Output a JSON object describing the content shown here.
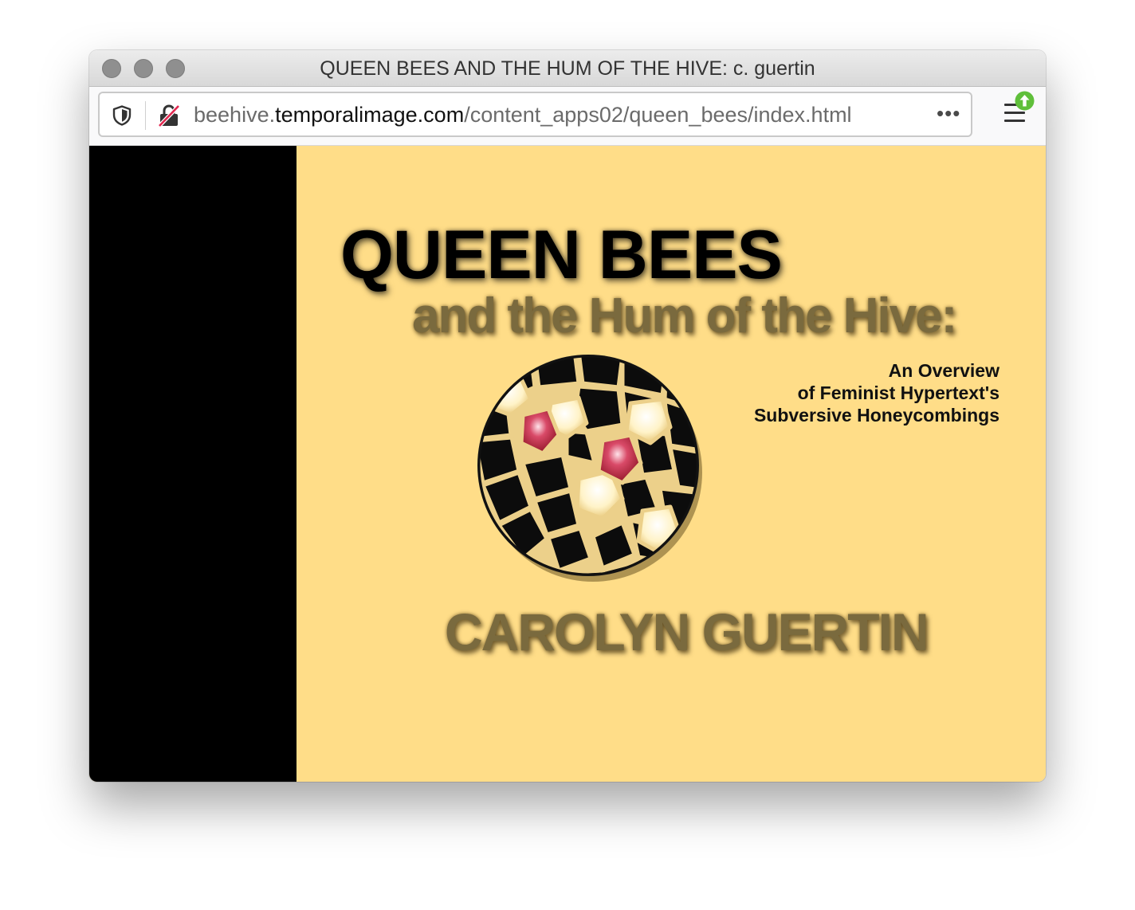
{
  "window": {
    "title": "QUEEN BEES AND THE HUM OF THE HIVE: c. guertin"
  },
  "urlbar": {
    "url_prefix": "beehive.",
    "url_host": "temporalimage.com",
    "url_path": "/content_apps02/queen_bees/index.html",
    "more_label": "•••"
  },
  "icons": {
    "tracking": "shield-icon",
    "security": "insecure-lock-icon",
    "menu": "hamburger-menu-icon",
    "update": "update-arrow-icon"
  },
  "page": {
    "title": "QUEEN BEES",
    "subtitle": "and the Hum of the Hive:",
    "tagline_1": "An Overview",
    "tagline_2": "of Feminist Hypertext's",
    "tagline_3": "Subversive Honeycombings",
    "author": "CAROLYN GUERTIN"
  },
  "colors": {
    "page_background": "#ffdd88",
    "left_panel": "#000000",
    "subtitle_text": "#7a6a3e",
    "update_badge": "#5fbf3a"
  }
}
